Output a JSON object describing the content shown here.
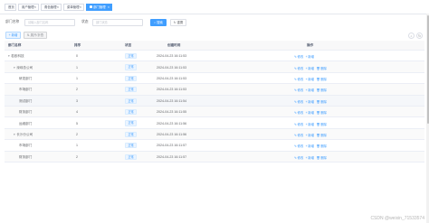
{
  "tags": [
    {
      "label": "首页",
      "active": false
    },
    {
      "label": "用户管理",
      "active": false
    },
    {
      "label": "角色管理",
      "active": false
    },
    {
      "label": "菜单管理",
      "active": false
    },
    {
      "label": "部门管理",
      "active": true
    }
  ],
  "search": {
    "dept_label": "部门名称",
    "dept_placeholder": "请输入部门名称",
    "status_label": "状态",
    "status_placeholder": "部门状态",
    "search_button": "搜索",
    "reset_button": "重置"
  },
  "actions": {
    "add_button": "新增",
    "expand_button": "展开/折叠"
  },
  "table": {
    "headers": [
      "部门名称",
      "排序",
      "状态",
      "创建时间",
      "操作"
    ],
    "rows": [
      {
        "name": "若依科技",
        "order": "0",
        "status": "正常",
        "time": "2024-04-23 16:11:53",
        "ops": [
          "修改",
          "新增"
        ],
        "level": 0,
        "expand": "▾"
      },
      {
        "name": "深圳总公司",
        "order": "1",
        "status": "正常",
        "time": "2024-04-23 16:11:53",
        "ops": [
          "修改",
          "新增",
          "删除"
        ],
        "level": 1,
        "expand": "▾"
      },
      {
        "name": "研发部门",
        "order": "1",
        "status": "正常",
        "time": "2024-04-23 16:11:53",
        "ops": [
          "修改",
          "新增",
          "删除"
        ],
        "level": 2,
        "expand": ""
      },
      {
        "name": "市场部门",
        "order": "2",
        "status": "正常",
        "time": "2024-04-23 16:11:53",
        "ops": [
          "修改",
          "新增",
          "删除"
        ],
        "level": 2,
        "expand": ""
      },
      {
        "name": "测试部门",
        "order": "3",
        "status": "正常",
        "time": "2024-04-23 16:11:54",
        "ops": [
          "修改",
          "新增",
          "删除"
        ],
        "level": 2,
        "expand": ""
      },
      {
        "name": "财务部门",
        "order": "4",
        "status": "正常",
        "time": "2024-04-23 16:11:55",
        "ops": [
          "修改",
          "新增",
          "删除"
        ],
        "level": 2,
        "expand": ""
      },
      {
        "name": "运维部门",
        "order": "5",
        "status": "正常",
        "time": "2024-04-23 16:11:56",
        "ops": [
          "修改",
          "新增",
          "删除"
        ],
        "level": 2,
        "expand": ""
      },
      {
        "name": "长沙分公司",
        "order": "2",
        "status": "正常",
        "time": "2024-04-23 16:11:56",
        "ops": [
          "修改",
          "新增",
          "删除"
        ],
        "level": 1,
        "expand": "▾"
      },
      {
        "name": "市场部门",
        "order": "1",
        "status": "正常",
        "time": "2024-04-23 16:11:57",
        "ops": [
          "修改",
          "新增",
          "删除"
        ],
        "level": 2,
        "expand": ""
      },
      {
        "name": "财务部门",
        "order": "2",
        "status": "正常",
        "time": "2024-04-23 16:11:57",
        "ops": [
          "修改",
          "新增",
          "删除"
        ],
        "level": 2,
        "expand": ""
      }
    ]
  },
  "watermark": "CSDN @weixin_71533574",
  "colors": {
    "primary": "#409eff",
    "border": "#ebeef5",
    "text": "#606266"
  }
}
